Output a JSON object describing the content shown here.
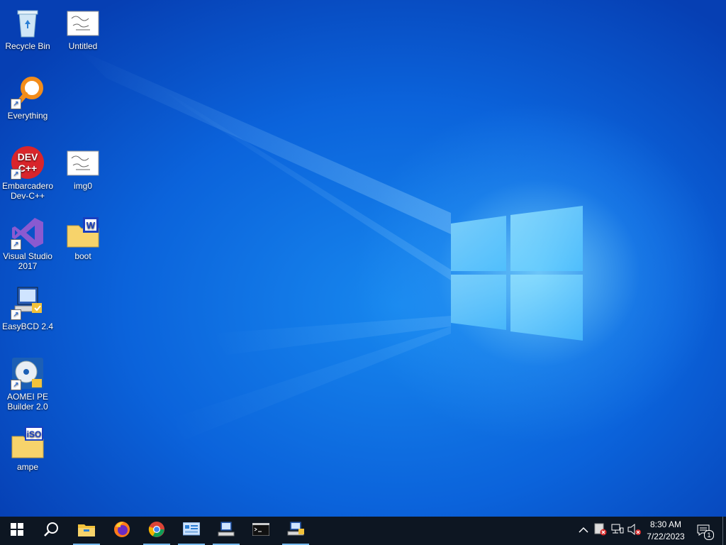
{
  "desktop": {
    "icons": [
      {
        "name": "recycle-bin",
        "label": "Recycle Bin",
        "icon": "recycle-bin-icon"
      },
      {
        "name": "untitled",
        "label": "Untitled",
        "icon": "image-file-icon"
      },
      {
        "name": "everything",
        "label": "Everything",
        "icon": "magnifier-icon"
      },
      {
        "name": "dev-cpp",
        "label": "Embarcadero Dev-C++",
        "icon": "dev-cpp-icon",
        "badge_text": "DEV C++"
      },
      {
        "name": "img0",
        "label": "img0",
        "icon": "image-file-icon"
      },
      {
        "name": "visual-studio",
        "label": "Visual Studio 2017",
        "icon": "visual-studio-icon"
      },
      {
        "name": "boot",
        "label": "boot",
        "icon": "folder-icon"
      },
      {
        "name": "easybcd",
        "label": "EasyBCD 2.4",
        "icon": "easybcd-icon"
      },
      {
        "name": "aomei",
        "label": "AOMEI PE Builder 2.0",
        "icon": "aomei-disc-icon"
      },
      {
        "name": "ampe",
        "label": "ampe",
        "icon": "folder-iso-icon",
        "badge_text": "iSO"
      }
    ]
  },
  "taskbar": {
    "buttons": [
      {
        "name": "start",
        "icon": "windows-start-icon"
      },
      {
        "name": "search",
        "icon": "search-icon"
      },
      {
        "name": "file-explorer",
        "icon": "file-explorer-icon",
        "running": true
      },
      {
        "name": "firefox",
        "icon": "firefox-icon"
      },
      {
        "name": "chrome",
        "icon": "chrome-icon",
        "running": true
      },
      {
        "name": "control-panel",
        "icon": "control-panel-icon",
        "running": true
      },
      {
        "name": "computer",
        "icon": "computer-icon",
        "running": true
      },
      {
        "name": "command-prompt",
        "icon": "cmd-icon"
      },
      {
        "name": "network-computer",
        "icon": "network-computer-icon",
        "running": true
      }
    ],
    "tray": {
      "icons": [
        "chevron-up-icon",
        "security-shield-icon",
        "network-icon",
        "volume-muted-icon"
      ],
      "time": "8:30 AM",
      "date": "7/22/2023",
      "notification_count": "1"
    }
  },
  "colors": {
    "taskbar_bg": "#0d1622",
    "desktop_blue": "#0b63db",
    "running_indicator": "#76b9ed"
  }
}
